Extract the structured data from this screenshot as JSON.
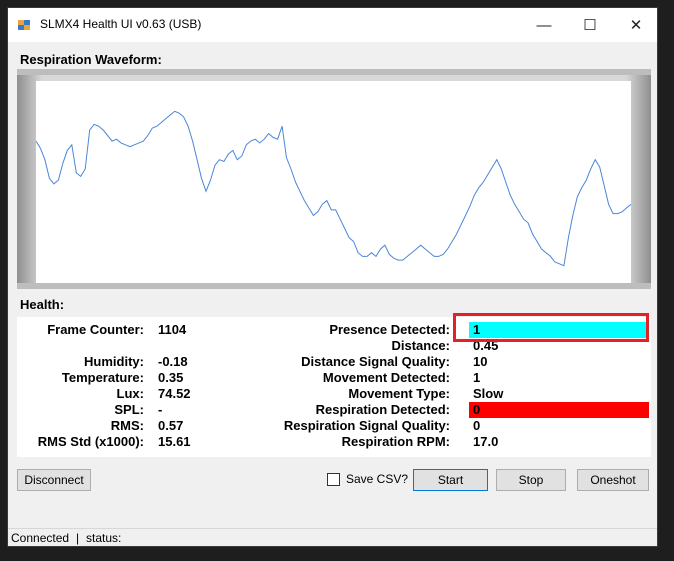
{
  "window": {
    "title": "SLMX4 Health UI v0.63 (USB)",
    "controls": {
      "minimize": "—",
      "maximize": "☐",
      "close": "✕"
    }
  },
  "waveform": {
    "label": "Respiration Waveform:",
    "line_color": "#4a86d6"
  },
  "chart_data": {
    "type": "line",
    "title": "",
    "series": [
      {
        "values": [
          0.72,
          0.68,
          0.62,
          0.52,
          0.49,
          0.51,
          0.6,
          0.67,
          0.7,
          0.55,
          0.53,
          0.57,
          0.78,
          0.81,
          0.8,
          0.78,
          0.75,
          0.72,
          0.73,
          0.71,
          0.7,
          0.69,
          0.7,
          0.71,
          0.72,
          0.75,
          0.79,
          0.8,
          0.82,
          0.84,
          0.86,
          0.88,
          0.87,
          0.85,
          0.8,
          0.72,
          0.62,
          0.52,
          0.45,
          0.51,
          0.59,
          0.62,
          0.61,
          0.65,
          0.67,
          0.62,
          0.64,
          0.7,
          0.72,
          0.73,
          0.71,
          0.73,
          0.76,
          0.74,
          0.73,
          0.8,
          0.63,
          0.57,
          0.5,
          0.45,
          0.4,
          0.36,
          0.32,
          0.34,
          0.38,
          0.4,
          0.35,
          0.35,
          0.3,
          0.25,
          0.2,
          0.18,
          0.12,
          0.1,
          0.1,
          0.12,
          0.1,
          0.14,
          0.16,
          0.11,
          0.09,
          0.08,
          0.08,
          0.1,
          0.12,
          0.14,
          0.16,
          0.14,
          0.12,
          0.1,
          0.1,
          0.11,
          0.14,
          0.18,
          0.22,
          0.27,
          0.32,
          0.37,
          0.43,
          0.47,
          0.5,
          0.54,
          0.58,
          0.62,
          0.57,
          0.5,
          0.43,
          0.38,
          0.34,
          0.3,
          0.28,
          0.22,
          0.18,
          0.14,
          0.12,
          0.1,
          0.07,
          0.06,
          0.05,
          0.2,
          0.32,
          0.42,
          0.47,
          0.51,
          0.57,
          0.62,
          0.58,
          0.48,
          0.38,
          0.33,
          0.33,
          0.34,
          0.36,
          0.38
        ]
      }
    ],
    "ylim": [
      0,
      1
    ],
    "grid": false,
    "legend": "none"
  },
  "health": {
    "label": "Health:",
    "left": [
      {
        "label": "Frame Counter:",
        "value": "1104"
      },
      {
        "label": "Humidity:",
        "value": "-0.18"
      },
      {
        "label": "Temperature:",
        "value": "0.35"
      },
      {
        "label": "Lux:",
        "value": "74.52"
      },
      {
        "label": "SPL:",
        "value": "-"
      },
      {
        "label": "RMS:",
        "value": "0.57"
      },
      {
        "label": "RMS Std (x1000):",
        "value": "15.61"
      }
    ],
    "right": {
      "presence_detected": {
        "label": "Presence Detected:",
        "value": "1",
        "color": "#00ffff"
      },
      "distance": {
        "label": "Distance:",
        "value": "0.45"
      },
      "distance_signal_quality": {
        "label": "Distance Signal Quality:",
        "value": "10"
      },
      "movement_detected": {
        "label": "Movement Detected:",
        "value": "1"
      },
      "movement_type": {
        "label": "Movement Type:",
        "value": "Slow"
      },
      "respiration_detected": {
        "label": "Respiration Detected:",
        "value": "0",
        "color": "#ff0000"
      },
      "respiration_signal_quality": {
        "label": "Respiration Signal Quality:",
        "value": "0"
      },
      "respiration_rpm": {
        "label": "Respiration RPM:",
        "value": "17.0"
      }
    },
    "highlight_color": "#e32228"
  },
  "buttons": {
    "disconnect": "Disconnect",
    "save_csv": "Save CSV?",
    "start": "Start",
    "stop": "Stop",
    "oneshot": "Oneshot"
  },
  "status": {
    "connection": "Connected",
    "separator": "|",
    "status_label": "status:"
  }
}
